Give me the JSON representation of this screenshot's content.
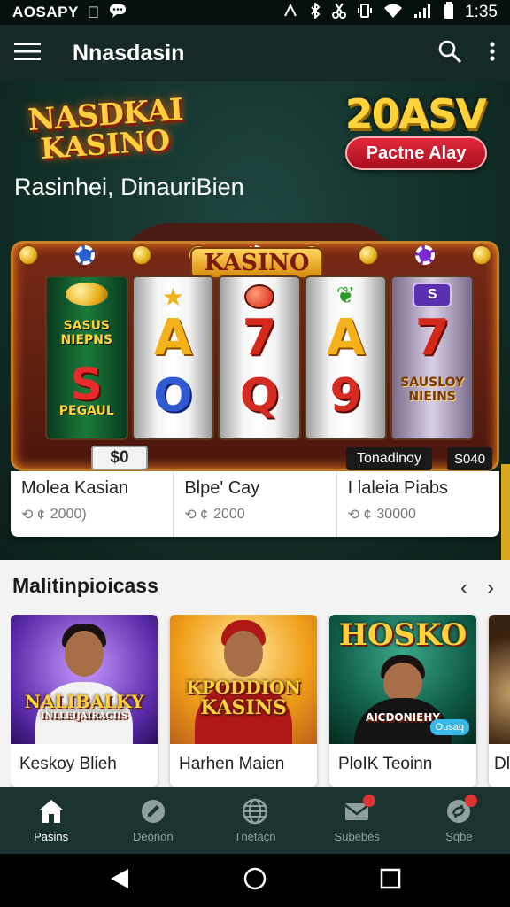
{
  "status_bar": {
    "carrier": "AOSAPY",
    "time": "1:35"
  },
  "app_bar": {
    "title": "Nnasdasin"
  },
  "hero": {
    "logo_line1": "NASDKAI",
    "logo_line2": "KASINO",
    "promo_amount": "20ASV",
    "promo_button": "Pactne Alay",
    "subtitle": "Rasinhei, DinauriBien"
  },
  "slot_machine": {
    "banner": "KASINO",
    "reel1_top": "SASUS",
    "reel1_mid": "NIEPNS",
    "reel1_symbol": "S",
    "reel1_bottom": "PEGAUL",
    "reel2_top": "A",
    "reel2_bottom": "O",
    "reel3_top": "7",
    "reel3_bottom": "Q",
    "reel4_top": "A",
    "reel4_bottom": "9",
    "reel5_badge": "S",
    "reel5_top": "7",
    "reel5_text1": "SAUSLOY",
    "reel5_text2": "NIEINS",
    "bet_label": "$0",
    "ticker_label": "Tonadinoy",
    "ticker_value": "S040"
  },
  "jackpots": [
    {
      "name": "Molea Kasian",
      "amount": "2000)"
    },
    {
      "name": "Blpe' Cay",
      "amount": "2000"
    },
    {
      "name": "I laleia Piabs",
      "amount": "30000"
    }
  ],
  "section": {
    "title": "Malitinpioicass",
    "prev_arrow": "‹",
    "next_arrow": "›"
  },
  "games": [
    {
      "name": "Keskoy Blieh",
      "art_title": "NALIBALKY",
      "art_subtitle": "INLLEIJAIRACIIS"
    },
    {
      "name": "Harhen  Maien",
      "art_title": "KPODDION",
      "art_subtitle": "KASINS"
    },
    {
      "name": "PloIK  Teoinn",
      "art_title": "HOSKO",
      "art_subtitle": "AICDONIEHY",
      "art_badge": "Ousaq"
    },
    {
      "name": "Dla"
    }
  ],
  "bottom_nav": [
    {
      "label": "Pasins",
      "icon": "home-icon",
      "active": true
    },
    {
      "label": "Deonon",
      "icon": "edit-icon",
      "active": false
    },
    {
      "label": "Tnetacn",
      "icon": "globe-icon",
      "active": false
    },
    {
      "label": "Subebes",
      "icon": "mail-icon",
      "active": false
    },
    {
      "label": "Sqbe",
      "icon": "refresh-icon",
      "active": false
    }
  ],
  "colors": {
    "app_bar": "#152a27",
    "accent_gold": "#ffd23a",
    "promo_red": "#d42031",
    "nav_bg": "#1b3431"
  }
}
